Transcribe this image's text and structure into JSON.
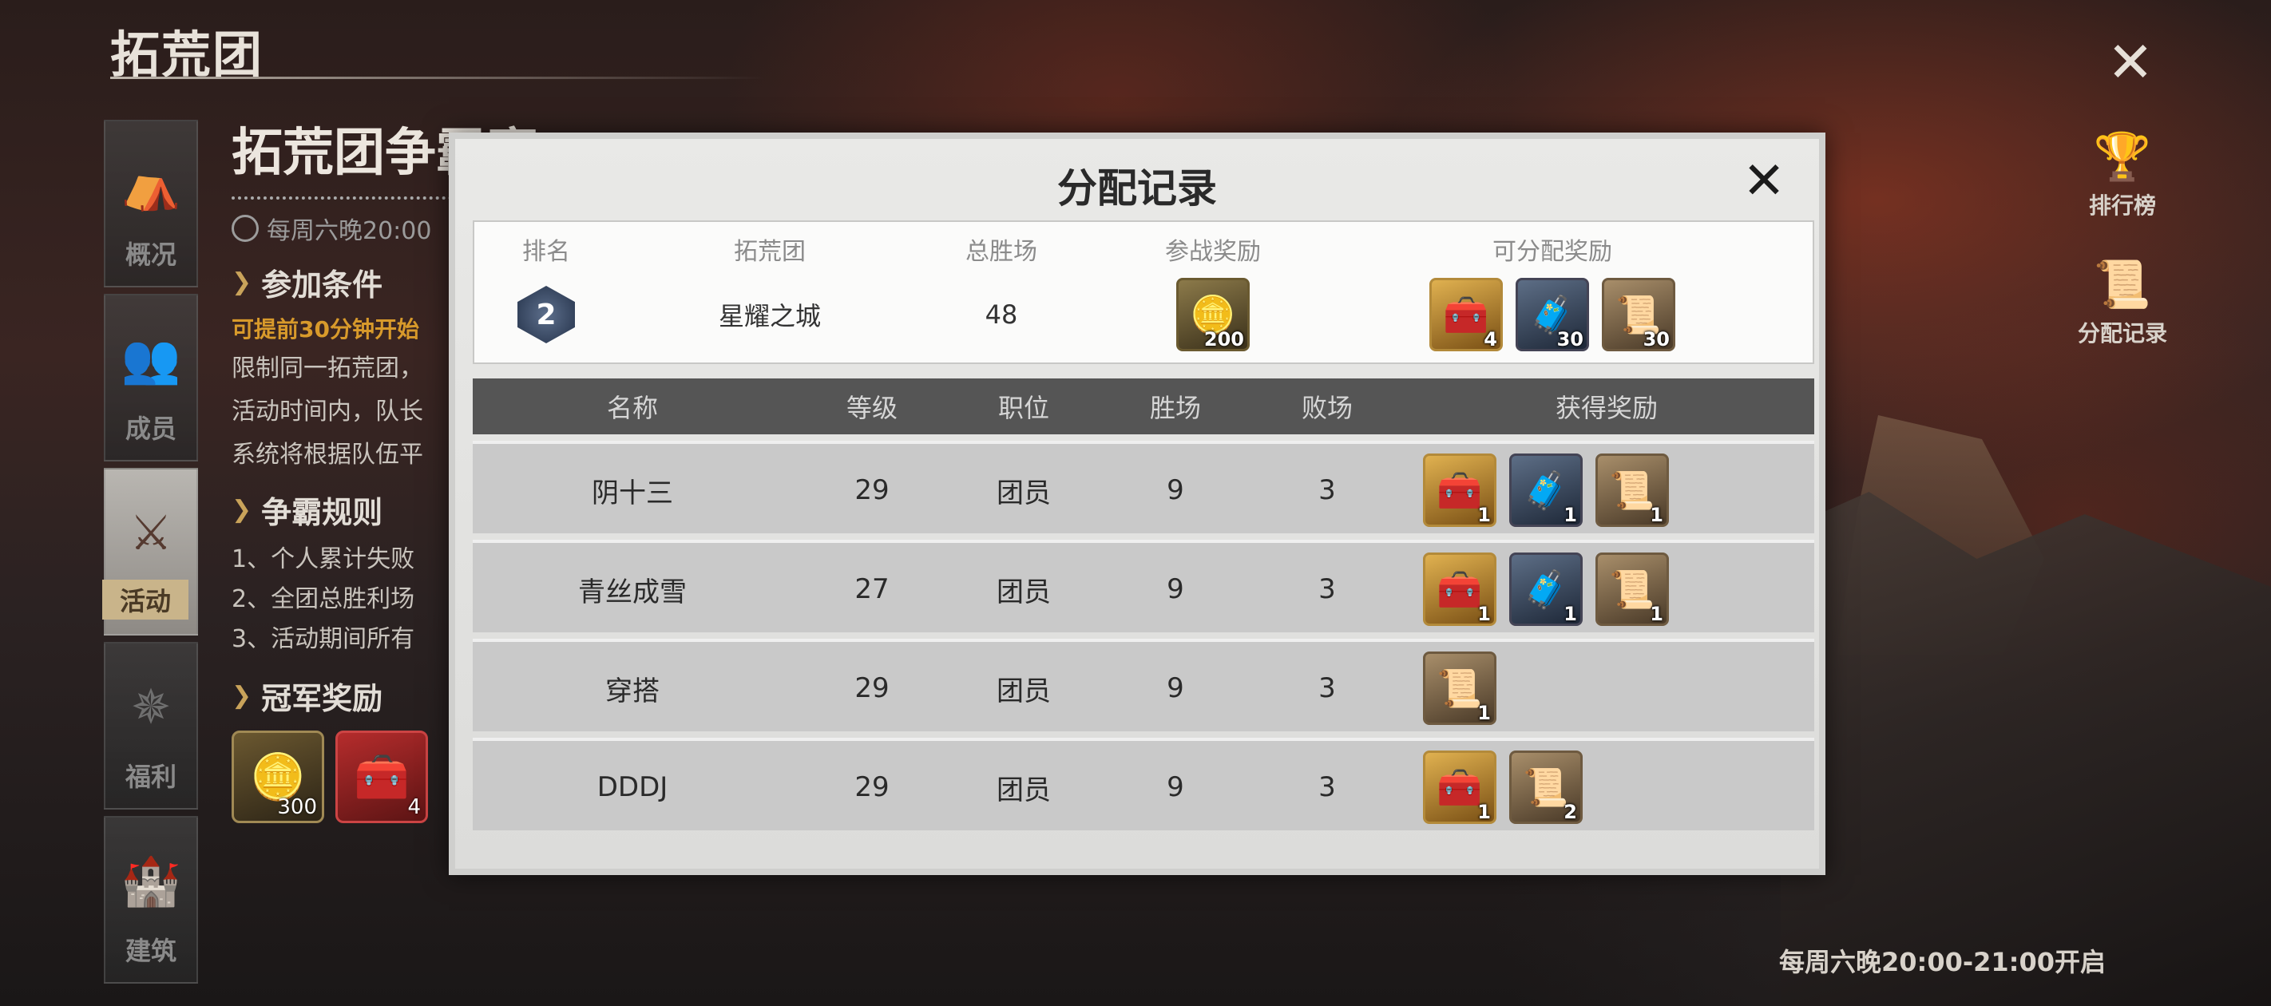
{
  "page": {
    "title": "拓荒团",
    "close_icon": "crossed-swords-close-icon"
  },
  "left_nav": [
    {
      "label": "概况",
      "icon": "tent-icon",
      "glyph": "⛺",
      "active": false
    },
    {
      "label": "成员",
      "icon": "members-icon",
      "glyph": "👥",
      "active": false
    },
    {
      "label": "活动",
      "icon": "crossed-swords-icon",
      "glyph": "⚔",
      "active": true
    },
    {
      "label": "福利",
      "icon": "compass-icon",
      "glyph": "✵",
      "active": false
    },
    {
      "label": "建筑",
      "icon": "castle-icon",
      "glyph": "🏰",
      "active": false
    }
  ],
  "info": {
    "event_title": "拓荒团争霸赛",
    "time_text": "每周六晚20:00",
    "section_conditions": "参加条件",
    "orange_note": "可提前30分钟开始",
    "lines": [
      "限制同一拓荒团，",
      "活动时间内，队长",
      "系统将根据队伍平"
    ],
    "section_rules": "争霸规则",
    "rules": [
      "1、个人累计失败",
      "2、全团总胜利场",
      "3、活动期间所有"
    ],
    "section_rewards": "冠军奖励",
    "champion_rewards": [
      {
        "icon": "coin-icon",
        "glyph": "🪙",
        "count": "300",
        "style": "gold"
      },
      {
        "icon": "red-chest-icon",
        "glyph": "🧰",
        "count": "4",
        "style": "red"
      }
    ]
  },
  "side": {
    "ranking": {
      "label": "排行榜",
      "icon": "podium-icon",
      "glyph": "🏆"
    },
    "records": {
      "label": "分配记录",
      "icon": "scroll-quill-icon",
      "glyph": "📜"
    }
  },
  "bottom_note": "每周六晚20:00-21:00开启",
  "modal": {
    "title": "分配记录",
    "close_icon": "crossed-swords-close-icon",
    "summary_headers": [
      "排名",
      "拓荒团",
      "总胜场",
      "参战奖励",
      "可分配奖励"
    ],
    "summary": {
      "rank": "2",
      "team": "星耀之城",
      "total_wins": "48",
      "battle_reward": {
        "icon": "coin-icon",
        "glyph": "🪙",
        "count": "200",
        "style": "coin"
      },
      "distributable": [
        {
          "icon": "gold-chest-icon",
          "glyph": "🧰",
          "count": "4",
          "style": "gold-chest"
        },
        {
          "icon": "iron-chest-icon",
          "glyph": "🧳",
          "count": "30",
          "style": "iron-chest"
        },
        {
          "icon": "scroll-icon",
          "glyph": "📜",
          "count": "30",
          "style": "scroll"
        }
      ]
    },
    "table_headers": [
      "名称",
      "等级",
      "职位",
      "胜场",
      "败场",
      "获得奖励"
    ],
    "rows": [
      {
        "name": "阴十三",
        "level": "29",
        "role": "团员",
        "wins": "9",
        "losses": "3",
        "rewards": [
          {
            "icon": "gold-chest-icon",
            "glyph": "🧰",
            "count": "1",
            "style": "gold-chest"
          },
          {
            "icon": "iron-chest-icon",
            "glyph": "🧳",
            "count": "1",
            "style": "iron-chest"
          },
          {
            "icon": "scroll-icon",
            "glyph": "📜",
            "count": "1",
            "style": "scroll"
          }
        ]
      },
      {
        "name": "青丝成雪",
        "level": "27",
        "role": "团员",
        "wins": "9",
        "losses": "3",
        "rewards": [
          {
            "icon": "gold-chest-icon",
            "glyph": "🧰",
            "count": "1",
            "style": "gold-chest"
          },
          {
            "icon": "iron-chest-icon",
            "glyph": "🧳",
            "count": "1",
            "style": "iron-chest"
          },
          {
            "icon": "scroll-icon",
            "glyph": "📜",
            "count": "1",
            "style": "scroll"
          }
        ]
      },
      {
        "name": "穿搭",
        "level": "29",
        "role": "团员",
        "wins": "9",
        "losses": "3",
        "rewards": [
          {
            "icon": "scroll-icon",
            "glyph": "📜",
            "count": "1",
            "style": "scroll"
          }
        ]
      },
      {
        "name": "DDDJ",
        "level": "29",
        "role": "团员",
        "wins": "9",
        "losses": "3",
        "rewards": [
          {
            "icon": "gold-chest-icon",
            "glyph": "🧰",
            "count": "1",
            "style": "gold-chest"
          },
          {
            "icon": "scroll-icon",
            "glyph": "📜",
            "count": "2",
            "style": "scroll"
          }
        ]
      }
    ]
  }
}
